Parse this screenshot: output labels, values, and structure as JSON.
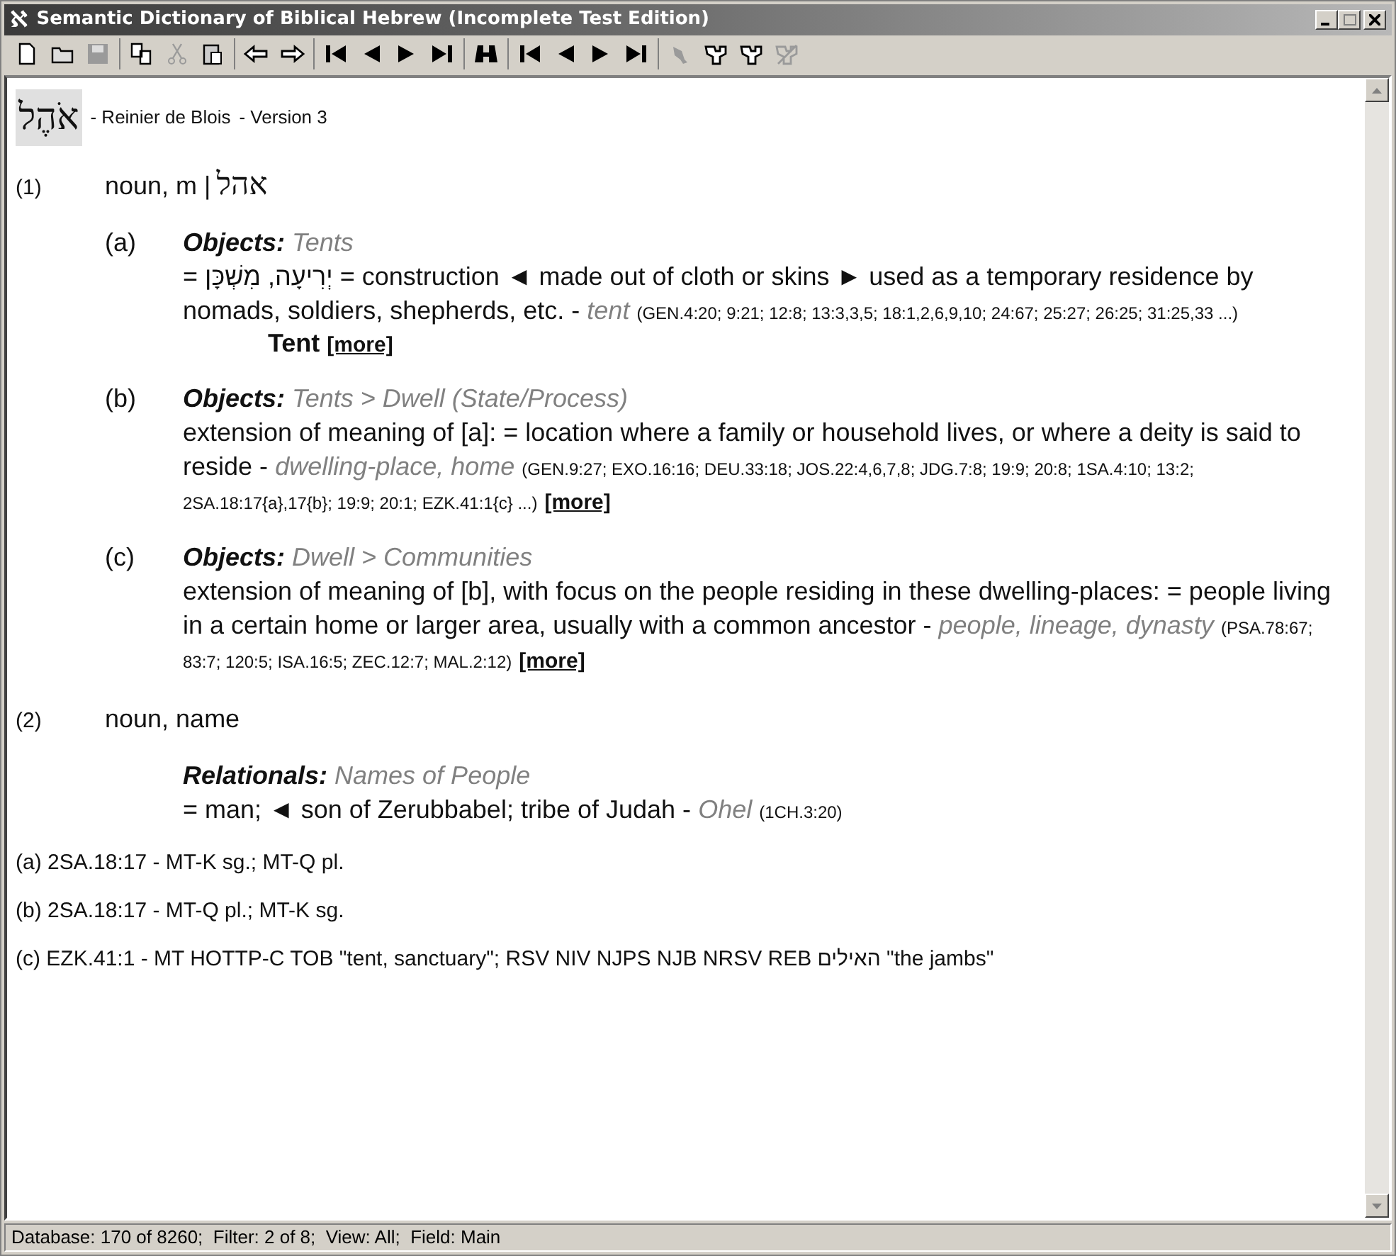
{
  "window": {
    "icon": "ℵ",
    "title": "Semantic Dictionary of Biblical Hebrew (Incomplete Test Edition)"
  },
  "toolbar": {
    "groups": [
      [
        {
          "kind": "new",
          "disabled": false
        },
        {
          "kind": "open",
          "disabled": false
        },
        {
          "kind": "save",
          "disabled": true
        }
      ],
      [
        {
          "kind": "copy",
          "disabled": false
        },
        {
          "kind": "cut",
          "disabled": true
        },
        {
          "kind": "paste",
          "disabled": false
        }
      ],
      [
        {
          "kind": "back",
          "disabled": false
        },
        {
          "kind": "forward",
          "disabled": false
        }
      ],
      [
        {
          "kind": "first",
          "disabled": false
        },
        {
          "kind": "previous",
          "disabled": false
        },
        {
          "kind": "next",
          "disabled": false
        },
        {
          "kind": "last",
          "disabled": false
        }
      ],
      [
        {
          "kind": "find",
          "disabled": false
        }
      ],
      [
        {
          "kind": "first",
          "disabled": false
        },
        {
          "kind": "previous",
          "disabled": false
        },
        {
          "kind": "next",
          "disabled": false
        },
        {
          "kind": "last",
          "disabled": false
        }
      ],
      [
        {
          "kind": "mark",
          "disabled": true
        },
        {
          "kind": "filter",
          "disabled": false
        },
        {
          "kind": "filter",
          "disabled": false
        },
        {
          "kind": "unfilter",
          "disabled": true
        }
      ]
    ]
  },
  "entry": {
    "lemma": "אֹהֶל",
    "author": "- Reinier de Blois",
    "version": "- Version 3"
  },
  "senses": [
    {
      "number": "(1)",
      "pos": "noun, m |",
      "hebrew": "אהל",
      "subsenses": [
        {
          "letter": "(a)",
          "domain": "Objects:",
          "path": "Tents",
          "definition": "= יְרִיעָה, מִשְׁכָּן = construction ◄ made out of cloth or skins ► used as a temporary residence by nomads, soldiers, shepherds, etc.",
          "dash": "-",
          "gloss": "tent",
          "refs": "(GEN.4:20; 9:21; 12:8; 13:3,3,5; 18:1,2,6,9,10; 24:67; 25:27; 26:25; 31:25,33 ...)",
          "keyword": "Tent",
          "more": "[more]"
        },
        {
          "letter": "(b)",
          "domain": "Objects:",
          "path": "Tents > Dwell (State/Process)",
          "definition": "extension of meaning of [a]: = location where a family or household lives, or where a deity is said to reside",
          "dash": "-",
          "gloss": "dwelling-place, home",
          "refs": "(GEN.9:27; EXO.16:16; DEU.33:18; JOS.22:4,6,7,8; JDG.7:8; 19:9; 20:8; 1SA.4:10; 13:2; 2SA.18:17{a},17{b}; 19:9; 20:1; EZK.41:1{c} ...)",
          "more": "[more]"
        },
        {
          "letter": "(c)",
          "domain": "Objects:",
          "path": "Dwell > Communities",
          "definition": "extension of meaning of [b], with focus on the people residing in these dwelling-places: = people living in a certain home or larger area, usually with a common ancestor",
          "dash": "-",
          "gloss": "people, lineage, dynasty",
          "refs": "(PSA.78:67; 83:7; 120:5; ISA.16:5; ZEC.12:7; MAL.2:12)",
          "more": "[more]"
        }
      ]
    },
    {
      "number": "(2)",
      "pos": "noun, name",
      "subsenses": [
        {
          "domain": "Relationals:",
          "path": "Names of People",
          "definition": "= man; ◄ son of Zerubbabel; tribe of Judah",
          "dash": "-",
          "gloss": "Ohel",
          "refs": "(1CH.3:20)"
        }
      ]
    }
  ],
  "footnotes": [
    "(a) 2SA.18:17 - MT-K sg.; MT-Q pl.",
    "(b) 2SA.18:17 - MT-Q pl.; MT-K sg.",
    "(c) EZK.41:1 - MT HOTTP-C TOB \"tent, sanctuary\"; RSV NIV NJPS NJB NRSV REB האילים \"the jambs\""
  ],
  "status_bar": "Database: 170 of 8260;  Filter: 2 of 8;  View: All;  Field: Main"
}
